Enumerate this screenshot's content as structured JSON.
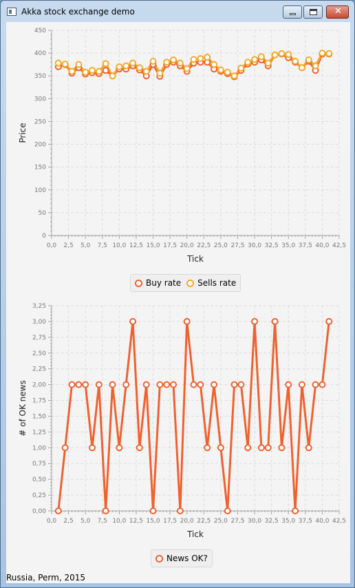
{
  "window": {
    "title": "Akka stock exchange demo",
    "buttons": {
      "minimize": "minimize-icon",
      "maximize": "maximize-icon",
      "close": "✕"
    }
  },
  "footer": {
    "text": "Russia, Perm, 2015"
  },
  "chart_data": [
    {
      "type": "line",
      "xlabel": "Tick",
      "ylabel": "Price",
      "xlim": [
        0,
        42.5
      ],
      "ylim": [
        0,
        450
      ],
      "x_ticks": [
        "0,0",
        "2,5",
        "5,0",
        "7,5",
        "10,0",
        "12,5",
        "15,0",
        "17,5",
        "20,0",
        "22,5",
        "25,0",
        "27,5",
        "30,0",
        "32,5",
        "35,0",
        "37,5",
        "40,0",
        "42,5"
      ],
      "y_ticks": [
        "0",
        "50",
        "100",
        "150",
        "200",
        "250",
        "300",
        "350",
        "400",
        "450"
      ],
      "grid": true,
      "legend": "bottom",
      "x": [
        1,
        2,
        3,
        4,
        5,
        6,
        7,
        8,
        9,
        10,
        11,
        12,
        13,
        14,
        15,
        16,
        17,
        18,
        19,
        20,
        21,
        22,
        23,
        24,
        25,
        26,
        27,
        28,
        29,
        30,
        31,
        32,
        33,
        34,
        35,
        36,
        37,
        38,
        39,
        40,
        41
      ],
      "series": [
        {
          "name": "Buy rate",
          "color": "#f0612e",
          "values": [
            370,
            375,
            356,
            368,
            354,
            357,
            355,
            362,
            350,
            365,
            365,
            372,
            363,
            350,
            375,
            349,
            375,
            380,
            372,
            360,
            378,
            380,
            380,
            365,
            360,
            355,
            348,
            362,
            376,
            380,
            385,
            372,
            396,
            398,
            390,
            380,
            368,
            382,
            362,
            398,
            398
          ]
        },
        {
          "name": "Sells rate",
          "color": "#f4a92a",
          "values": [
            378,
            376,
            360,
            375,
            358,
            362,
            360,
            377,
            350,
            370,
            372,
            378,
            368,
            360,
            382,
            356,
            380,
            385,
            378,
            366,
            386,
            388,
            391,
            375,
            363,
            358,
            350,
            367,
            380,
            386,
            392,
            378,
            396,
            399,
            397,
            382,
            368,
            385,
            372,
            400,
            399
          ]
        }
      ]
    },
    {
      "type": "line",
      "xlabel": "Tick",
      "ylabel": "# of OK news",
      "xlim": [
        0,
        42.5
      ],
      "ylim": [
        0,
        3.25
      ],
      "x_ticks": [
        "0,0",
        "2,5",
        "5,0",
        "7,5",
        "10,0",
        "12,5",
        "15,0",
        "17,5",
        "20,0",
        "22,5",
        "25,0",
        "27,5",
        "30,0",
        "32,5",
        "35,0",
        "37,5",
        "40,0",
        "42,5"
      ],
      "y_ticks": [
        "0,00",
        "0,25",
        "0,50",
        "0,75",
        "1,00",
        "1,25",
        "1,50",
        "1,75",
        "2,00",
        "2,25",
        "2,50",
        "2,75",
        "3,00",
        "3,25"
      ],
      "grid": true,
      "legend": "bottom",
      "x": [
        1,
        2,
        3,
        4,
        5,
        6,
        7,
        8,
        9,
        10,
        11,
        12,
        13,
        14,
        15,
        16,
        17,
        18,
        19,
        20,
        21,
        22,
        23,
        24,
        25,
        26,
        27,
        28,
        29,
        30,
        31,
        32,
        33,
        34,
        35,
        36,
        37,
        38,
        39,
        40,
        41
      ],
      "series": [
        {
          "name": "News OK?",
          "color": "#f0612e",
          "values": [
            0,
            1,
            2,
            2,
            2,
            1,
            2,
            0,
            2,
            1,
            2,
            3,
            1,
            2,
            0,
            2,
            2,
            2,
            0,
            3,
            2,
            2,
            1,
            2,
            1,
            0,
            2,
            2,
            1,
            3,
            1,
            1,
            3,
            1,
            2,
            0,
            2,
            1,
            2,
            2,
            3
          ]
        }
      ]
    }
  ]
}
